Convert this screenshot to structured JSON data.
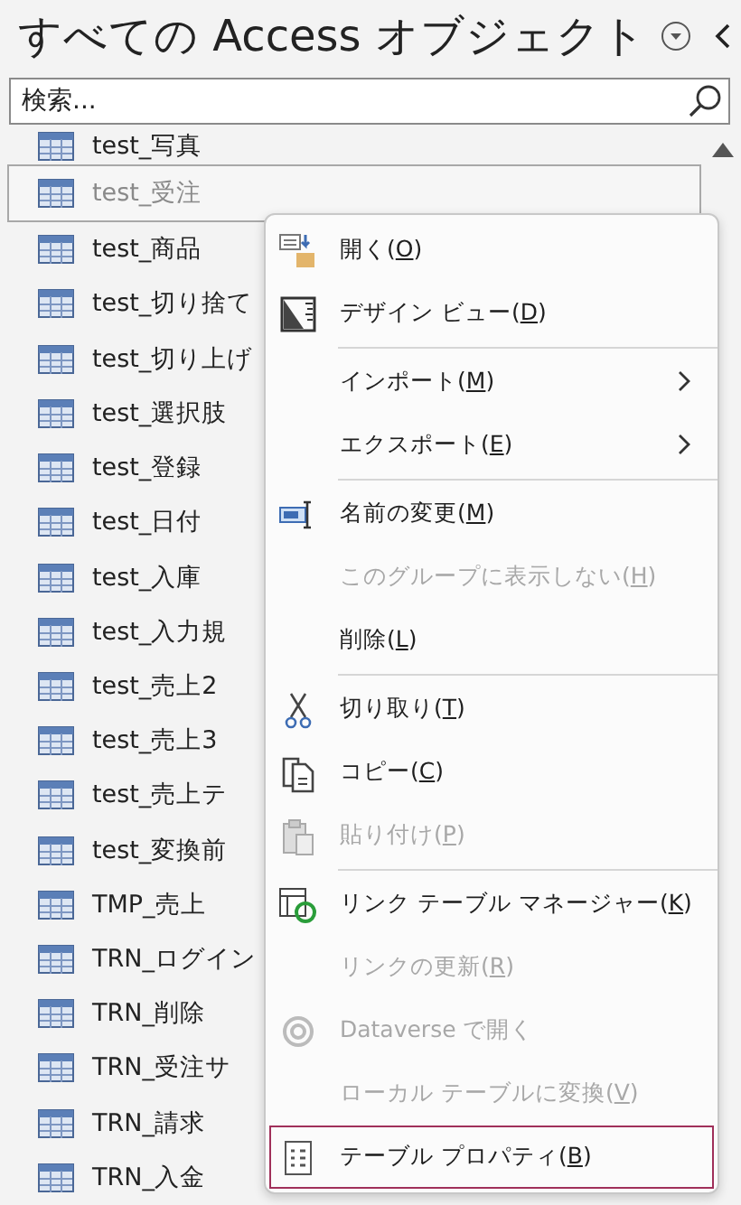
{
  "pane": {
    "title": "すべての Access オブジェクト"
  },
  "search": {
    "placeholder": "検索..."
  },
  "objects": [
    {
      "name": "test_写真",
      "selected": false
    },
    {
      "name": "test_受注",
      "selected": true
    },
    {
      "name": "test_商品",
      "selected": false
    },
    {
      "name": "test_切り捨て",
      "selected": false
    },
    {
      "name": "test_切り上げ",
      "selected": false
    },
    {
      "name": "test_選択肢",
      "selected": false
    },
    {
      "name": "test_登録",
      "selected": false
    },
    {
      "name": "test_日付",
      "selected": false
    },
    {
      "name": "test_入庫",
      "selected": false
    },
    {
      "name": "test_入力規",
      "selected": false
    },
    {
      "name": "test_売上2",
      "selected": false
    },
    {
      "name": "test_売上3",
      "selected": false
    },
    {
      "name": "test_売上テ",
      "selected": false
    },
    {
      "name": "test_変換前",
      "selected": false
    },
    {
      "name": "TMP_売上",
      "selected": false
    },
    {
      "name": "TRN_ログイン",
      "selected": false
    },
    {
      "name": "TRN_削除",
      "selected": false
    },
    {
      "name": "TRN_受注サ",
      "selected": false
    },
    {
      "name": "TRN_請求",
      "selected": false
    },
    {
      "name": "TRN_入金",
      "selected": false
    }
  ],
  "context_menu": {
    "items": [
      {
        "kind": "command",
        "before": "開く(",
        "key": "O",
        "after": ")",
        "disabled": false,
        "submenu": false,
        "selected": false
      },
      {
        "kind": "command",
        "before": "デザイン ビュー(",
        "key": "D",
        "after": ")",
        "disabled": false,
        "submenu": false,
        "selected": false
      },
      {
        "kind": "separator"
      },
      {
        "kind": "command",
        "before": "インポート(",
        "key": "M",
        "after": ")",
        "disabled": false,
        "submenu": true,
        "selected": false
      },
      {
        "kind": "command",
        "before": "エクスポート(",
        "key": "E",
        "after": ")",
        "disabled": false,
        "submenu": true,
        "selected": false
      },
      {
        "kind": "separator"
      },
      {
        "kind": "command",
        "before": "名前の変更(",
        "key": "M",
        "after": ")",
        "disabled": false,
        "submenu": false,
        "selected": false
      },
      {
        "kind": "command",
        "before": "このグループに表示しない(",
        "key": "H",
        "after": ")",
        "disabled": true,
        "submenu": false,
        "selected": false
      },
      {
        "kind": "command",
        "before": "削除(",
        "key": "L",
        "after": ")",
        "disabled": false,
        "submenu": false,
        "selected": false
      },
      {
        "kind": "separator"
      },
      {
        "kind": "command",
        "before": "切り取り(",
        "key": "T",
        "after": ")",
        "disabled": false,
        "submenu": false,
        "selected": false
      },
      {
        "kind": "command",
        "before": "コピー(",
        "key": "C",
        "after": ")",
        "disabled": false,
        "submenu": false,
        "selected": false
      },
      {
        "kind": "command",
        "before": "貼り付け(",
        "key": "P",
        "after": ")",
        "disabled": true,
        "submenu": false,
        "selected": false
      },
      {
        "kind": "separator"
      },
      {
        "kind": "command",
        "before": "リンク テーブル マネージャー(",
        "key": "K",
        "after": ")",
        "disabled": false,
        "submenu": false,
        "selected": false
      },
      {
        "kind": "command",
        "before": "リンクの更新(",
        "key": "R",
        "after": ")",
        "disabled": true,
        "submenu": false,
        "selected": false
      },
      {
        "kind": "command",
        "before": "Dataverse で開く",
        "disabled": true,
        "submenu": false,
        "selected": false
      },
      {
        "kind": "command",
        "before": "ローカル テーブルに変換(",
        "key": "V",
        "after": ")",
        "disabled": true,
        "submenu": false,
        "selected": false
      },
      {
        "kind": "command",
        "before": "テーブル プロパティ(",
        "key": "B",
        "after": ")",
        "disabled": false,
        "submenu": false,
        "selected": true
      }
    ]
  }
}
